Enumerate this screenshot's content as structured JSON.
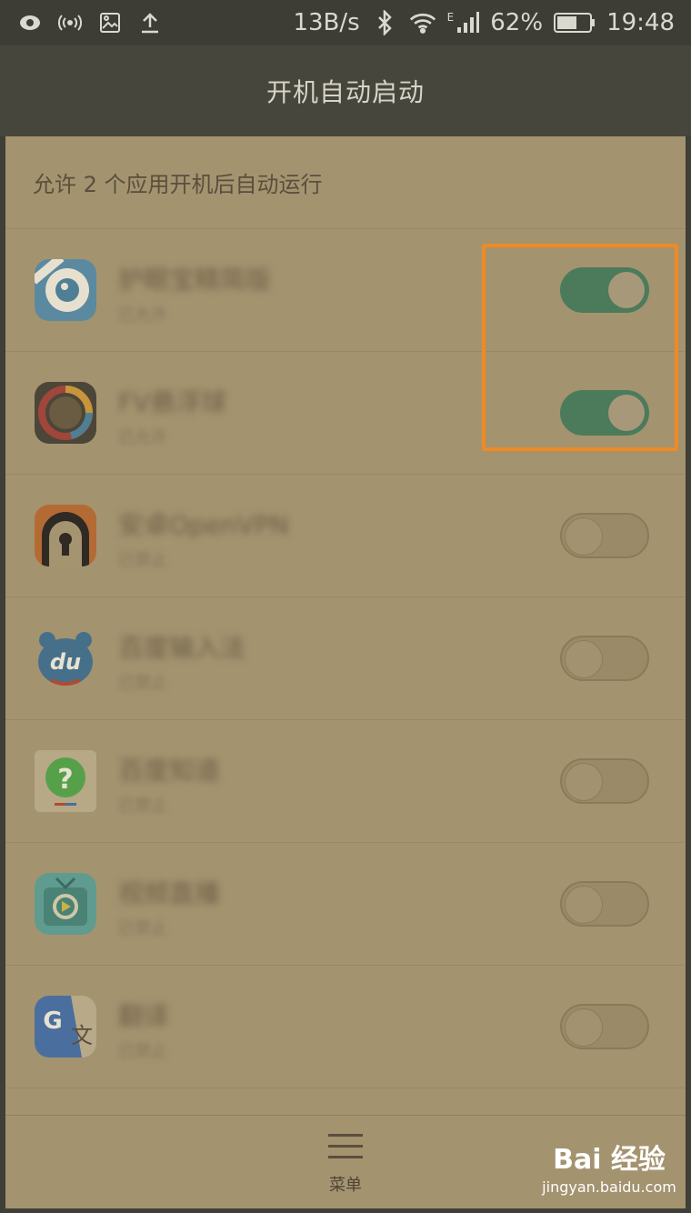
{
  "status_bar": {
    "speed": "13B/s",
    "network_type": "E",
    "battery": "62%",
    "time": "19:48",
    "icons": [
      "eye-icon",
      "hotspot-icon",
      "image-icon",
      "upload-icon",
      "bluetooth-icon",
      "wifi-icon",
      "signal-icon",
      "battery-icon"
    ]
  },
  "header": {
    "title": "开机自动启动"
  },
  "summary": "允许 2 个应用开机后自动运行",
  "apps": [
    {
      "name": "护眼宝精简版",
      "status": "已允许",
      "enabled": true,
      "icon": "eye-app-icon"
    },
    {
      "name": "FV悬浮球",
      "status": "已允许",
      "enabled": true,
      "icon": "ball-app-icon"
    },
    {
      "name": "安卓OpenVPN",
      "status": "已禁止",
      "enabled": false,
      "icon": "vpn-app-icon"
    },
    {
      "name": "百度输入法",
      "status": "已禁止",
      "enabled": false,
      "icon": "du-app-icon"
    },
    {
      "name": "百度知道",
      "status": "已禁止",
      "enabled": false,
      "icon": "zhidao-app-icon"
    },
    {
      "name": "视频直播",
      "status": "已禁止",
      "enabled": false,
      "icon": "tv-app-icon"
    },
    {
      "name": "翻译",
      "status": "已禁止",
      "enabled": false,
      "icon": "translate-app-icon"
    }
  ],
  "bottom": {
    "menu_label": "菜单"
  },
  "watermark": {
    "brand": "Bai 经验",
    "url": "jingyan.baidu.com"
  },
  "colors": {
    "toggle_on": "#4b7b5b",
    "highlight": "#f08a24",
    "content_bg": "#a4936f"
  }
}
